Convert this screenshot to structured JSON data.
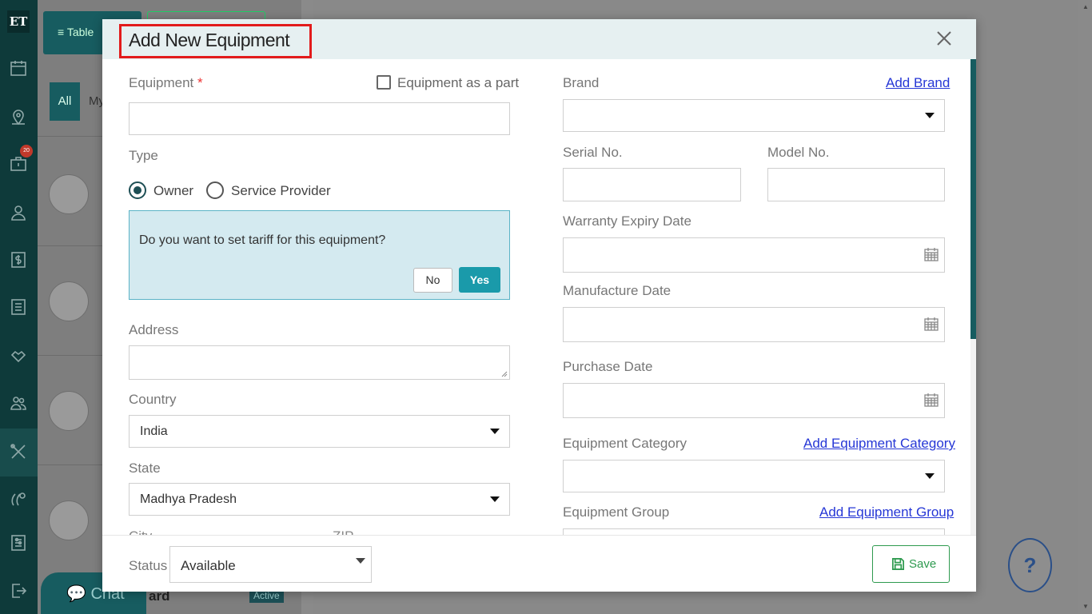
{
  "app": {
    "logo": "ET",
    "badge_count": "20"
  },
  "background": {
    "table_label": "Table",
    "tab_all": "All",
    "tab_my": "My",
    "chat_label": "Chat",
    "row_title_fragment": "ard",
    "row_status": "Active",
    "help_label": "?"
  },
  "modal": {
    "title": "Add New Equipment",
    "left": {
      "equipment_label": "Equipment",
      "required_mark": "*",
      "equipment_part_label": "Equipment as a part",
      "equipment_value": "",
      "type_label": "Type",
      "type_options": [
        "Owner",
        "Service Provider"
      ],
      "type_selected": "Owner",
      "tariff_question": "Do you want to set tariff for this equipment?",
      "tariff_no": "No",
      "tariff_yes": "Yes",
      "address_label": "Address",
      "address_value": "",
      "country_label": "Country",
      "country_value": "India",
      "state_label": "State",
      "state_value": "Madhya Pradesh",
      "city_label": "City",
      "zip_label": "ZIP"
    },
    "right": {
      "brand_label": "Brand",
      "add_brand": "Add Brand",
      "brand_value": "",
      "serial_label": "Serial No.",
      "model_label": "Model No.",
      "warranty_label": "Warranty Expiry Date",
      "manufacture_label": "Manufacture Date",
      "purchase_label": "Purchase Date",
      "category_label": "Equipment Category",
      "add_category": "Add Equipment Category",
      "group_label": "Equipment Group",
      "add_group": "Add Equipment Group"
    },
    "footer": {
      "status_label": "Status",
      "status_value": "Available",
      "save_label": "Save"
    }
  },
  "colors": {
    "primary": "#175c60",
    "accent": "#1a9aaa",
    "highlight_border": "#e21b1b",
    "link": "#2637d6",
    "save": "#2e9a4f"
  }
}
